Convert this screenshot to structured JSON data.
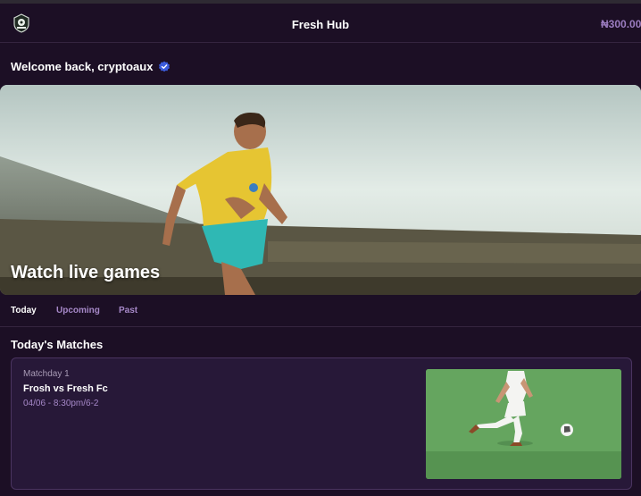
{
  "header": {
    "title": "Fresh Hub",
    "balance": "₦300.00",
    "logo_icon": "soccer-ball-crest-icon"
  },
  "welcome": {
    "text": "Welcome back, cryptoaux",
    "badge_icon": "verified-check-icon",
    "badge_color": "#3b5bdb"
  },
  "hero": {
    "caption": "Watch live games"
  },
  "tabs": [
    {
      "label": "Today",
      "active": true
    },
    {
      "label": "Upcoming",
      "active": false
    },
    {
      "label": "Past",
      "active": false
    }
  ],
  "section": {
    "title": "Today's Matches"
  },
  "matches": [
    {
      "matchday": "Matchday 1",
      "teams": "Frosh vs Fresh Fc",
      "datetime": "04/06 - 8:30pm/6-2"
    }
  ],
  "colors": {
    "background": "#1c0f25",
    "accent": "#a688c8",
    "card_border": "#4a3460"
  }
}
